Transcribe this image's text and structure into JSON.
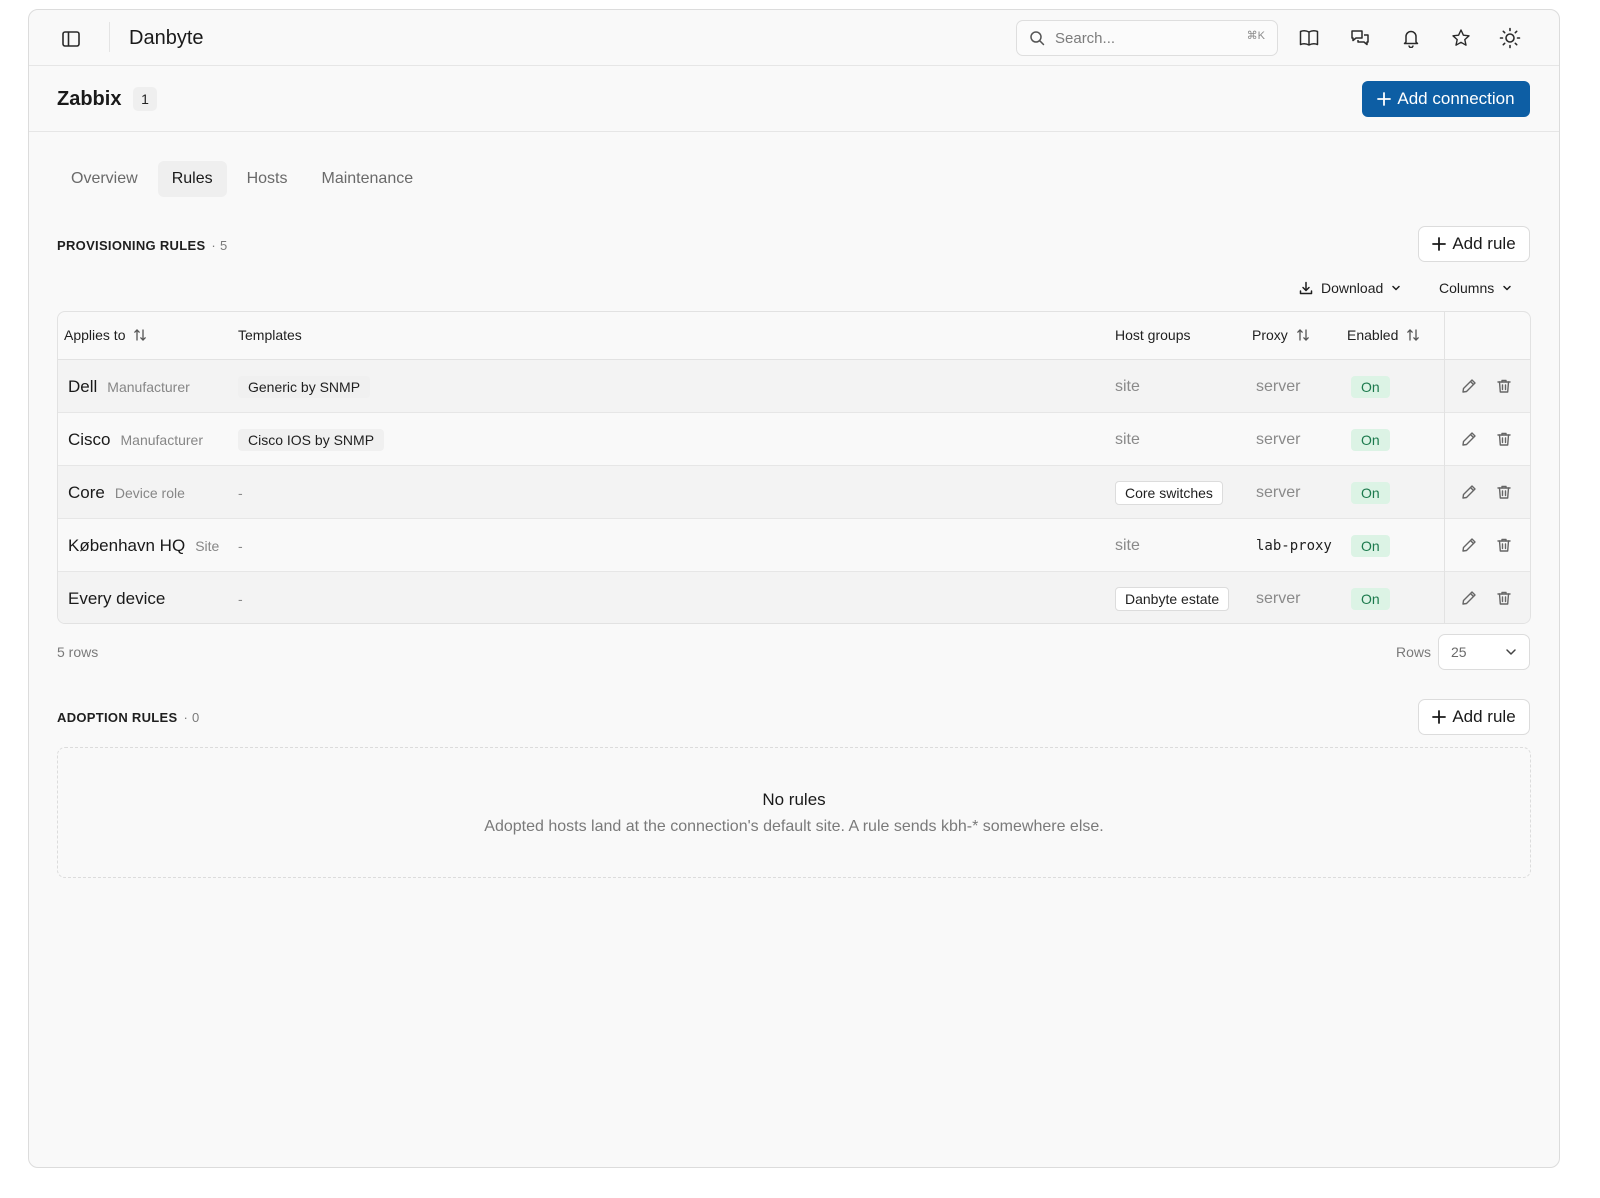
{
  "app": {
    "name": "Danbyte",
    "search_placeholder": "Search...",
    "search_shortcut": "⌘K"
  },
  "page": {
    "title": "Zabbix",
    "count": "1",
    "add_connection_label": "Add connection"
  },
  "tabs": [
    {
      "label": "Overview",
      "active": false
    },
    {
      "label": "Rules",
      "active": true
    },
    {
      "label": "Hosts",
      "active": false
    },
    {
      "label": "Maintenance",
      "active": false
    }
  ],
  "provisioning": {
    "heading": "PROVISIONING RULES",
    "count": "5",
    "add_rule_label": "Add rule",
    "download_label": "Download",
    "columns_label": "Columns",
    "headers": {
      "applies_to": "Applies to",
      "templates": "Templates",
      "host_groups": "Host groups",
      "proxy": "Proxy",
      "enabled": "Enabled"
    },
    "rows": [
      {
        "name": "Dell",
        "kind": "Manufacturer",
        "template": "Generic by SNMP",
        "host_group": "site",
        "proxy": "server",
        "enabled": "On"
      },
      {
        "name": "Cisco",
        "kind": "Manufacturer",
        "template": "Cisco IOS by SNMP",
        "host_group": "site",
        "proxy": "server",
        "enabled": "On"
      },
      {
        "name": "Core",
        "kind": "Device role",
        "template": "-",
        "host_group": "Core switches",
        "proxy": "server",
        "enabled": "On"
      },
      {
        "name": "København HQ",
        "kind": "Site",
        "template": "-",
        "host_group": "site",
        "proxy": "lab-proxy",
        "enabled": "On"
      },
      {
        "name": "Every device",
        "kind": "",
        "template": "-",
        "host_group": "Danbyte estate",
        "proxy": "server",
        "enabled": "On"
      }
    ],
    "row_count_text": "5 rows",
    "rows_label": "Rows",
    "rows_per_page": "25"
  },
  "adoption": {
    "heading": "ADOPTION RULES",
    "count": "0",
    "add_rule_label": "Add rule",
    "empty_title": "No rules",
    "empty_description": "Adopted hosts land at the connection's default site. A rule sends kbh-* somewhere else."
  },
  "colors": {
    "primary": "#0d5ea4",
    "on_badge_bg": "#dcf3e5",
    "on_badge_text": "#1c7a4d"
  },
  "icons": [
    "sidebar-toggle-icon",
    "search-icon",
    "book-icon",
    "chat-icon",
    "bell-icon",
    "star-icon",
    "sun-icon",
    "plus-icon",
    "download-icon",
    "chevron-down-icon",
    "sort-icon",
    "pencil-icon",
    "trash-icon"
  ]
}
